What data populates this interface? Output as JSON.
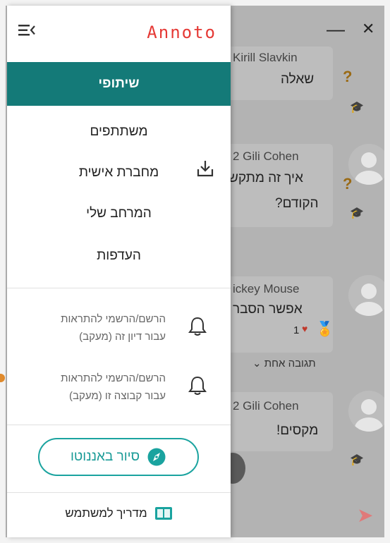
{
  "window": {
    "minimize_label": "—",
    "close_label": "✕"
  },
  "brand": {
    "name": "Annoto"
  },
  "nav": {
    "active_label": "שיתופי",
    "items": [
      {
        "label": "משתתפים"
      },
      {
        "label": "מחברת אישית",
        "icon": "download-icon"
      },
      {
        "label": "המרחב שלי"
      },
      {
        "label": "העדפות"
      }
    ]
  },
  "notifications": [
    {
      "line1": "הרשם/הרשמי להתראות",
      "line2": "עבור דיון זה (מעקב)",
      "icon": "bell-icon"
    },
    {
      "line1": "הרשם/הרשמי להתראות",
      "line2": "עבור קבוצה זו (מעקב)",
      "icon": "bell-icon"
    }
  ],
  "tour": {
    "label": "סיור באננוטו",
    "icon": "compass-icon"
  },
  "guide": {
    "label": "מדריך למשתמש",
    "icon": "book-icon"
  },
  "background_messages": [
    {
      "author": "Kirill Slavkin",
      "text": "שאלה",
      "badge": "?"
    },
    {
      "author": "2 Gili Cohen",
      "text": "איך זה מתקש",
      "text2": "הקודם?",
      "badge": "?"
    },
    {
      "author": "ickey Mouse",
      "text": "אפשר הסבר",
      "likes": "1",
      "replies": "תגובה אחת"
    },
    {
      "author": "2 Gili Cohen",
      "text": "מקסים!"
    }
  ],
  "colors": {
    "accent": "#147a78",
    "brand": "#e53935",
    "tour": "#1aa39f"
  }
}
